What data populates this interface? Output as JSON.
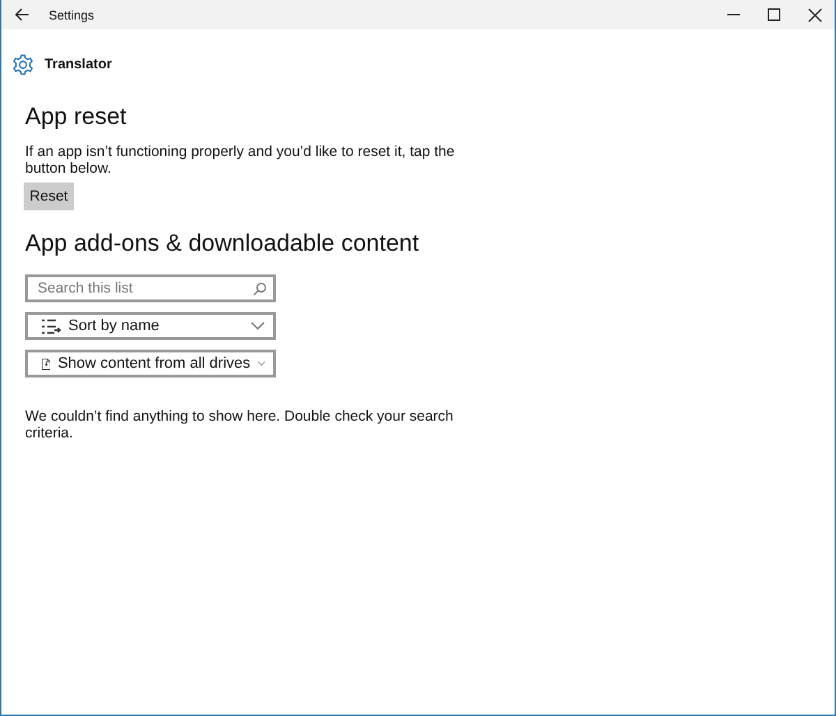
{
  "window": {
    "title": "Settings"
  },
  "header": {
    "app_name": "Translator"
  },
  "reset_section": {
    "heading": "App reset",
    "description": "If an app isn’t functioning properly and you’d like to reset it, tap the button below.",
    "button": "Reset"
  },
  "addons_section": {
    "heading": "App add-ons & downloadable content",
    "search": {
      "placeholder": "Search this list"
    },
    "dropdowns": [
      {
        "kind": "sort",
        "value": "Sort by name"
      },
      {
        "kind": "drive",
        "value": "Show content from all drives"
      }
    ],
    "message": "We couldn’t find anything to show here. Double check your search criteria."
  }
}
